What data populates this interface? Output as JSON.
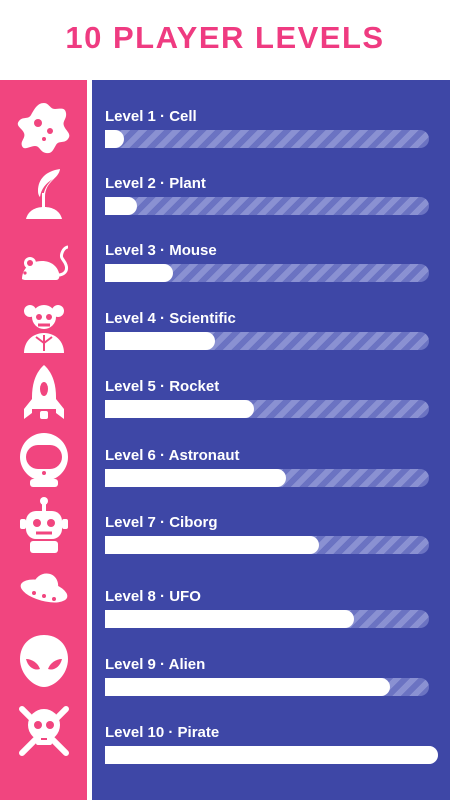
{
  "title": "10 PLAYER LEVELS",
  "colors": {
    "accent_pink": "#ef3b81",
    "sidebar_pink": "#f1457f",
    "panel_blue": "#3e47a6",
    "bar_fill": "#ffffff"
  },
  "levels": [
    {
      "label": "Level 1 · Cell",
      "icon": "cell-icon",
      "progress": 0.02
    },
    {
      "label": "Level 2 · Plant",
      "icon": "plant-icon",
      "progress": 0.1
    },
    {
      "label": "Level 3 · Mouse",
      "icon": "mouse-icon",
      "progress": 0.21
    },
    {
      "label": "Level 4 · Scientific",
      "icon": "scientist-icon",
      "progress": 0.34
    },
    {
      "label": "Level 5 · Rocket",
      "icon": "rocket-icon",
      "progress": 0.46
    },
    {
      "label": "Level 6 · Astronaut",
      "icon": "astronaut-helmet-icon",
      "progress": 0.56
    },
    {
      "label": "Level 7 · Ciborg",
      "icon": "robot-icon",
      "progress": 0.66
    },
    {
      "label": "Level 8 · UFO",
      "icon": "ufo-icon",
      "progress": 0.77
    },
    {
      "label": "Level 9 · Alien",
      "icon": "alien-icon",
      "progress": 0.88
    },
    {
      "label": "Level 10 · Pirate",
      "icon": "skull-crossbones-icon",
      "progress": 1.0
    }
  ]
}
